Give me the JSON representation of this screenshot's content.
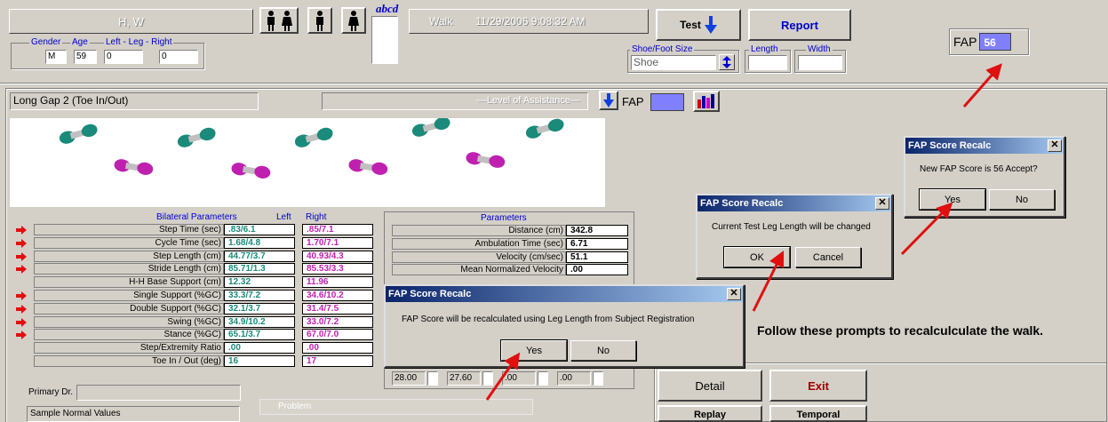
{
  "header": {
    "patient_name": "H, W",
    "gender_label": "Gender",
    "age_label": "Age",
    "leg_label": "Left - Leg - Right",
    "gender": "M",
    "age": "59",
    "left_leg": "0",
    "right_leg": "0",
    "abcd_label": "abcd",
    "test_type": "Walk",
    "test_datetime": "11/29/2006 9:08:32 AM",
    "test_button": "Test",
    "report_button": "Report",
    "shoe_group_label": "Shoe/Foot Size",
    "shoe_value": "Shoe",
    "length_label": "Length",
    "width_label": "Width",
    "fap_label": "FAP",
    "fap_value": "56"
  },
  "walk": {
    "name": "Long Gap 2 (Toe In/Out)",
    "assistance_label": "Level of Assistance",
    "fap_label": "FAP",
    "left_color": "#1a8a7a",
    "right_color": "#c020b0"
  },
  "bilateral": {
    "header": "Bilateral  Parameters",
    "left_header": "Left",
    "right_header": "Right",
    "rows": [
      {
        "label": "Step Time (sec)",
        "left": ".83/6.1",
        "right": ".85/7.1",
        "flag": true
      },
      {
        "label": "Cycle Time (sec)",
        "left": "1.68/4.8",
        "right": "1.70/7.1",
        "flag": true
      },
      {
        "label": "Step Length (cm)",
        "left": "44.77/3.7",
        "right": "40.93/4.3",
        "flag": true
      },
      {
        "label": "Stride Length (cm)",
        "left": "85.71/1.3",
        "right": "85.53/3.3",
        "flag": true
      },
      {
        "label": "H-H Base Support (cm)",
        "left": "12.32",
        "right": "11.96",
        "flag": false
      },
      {
        "label": "Single Support (%GC)",
        "left": "33.3/7.2",
        "right": "34.6/10.2",
        "flag": true
      },
      {
        "label": "Double Support (%GC)",
        "left": "32.1/3.7",
        "right": "31.4/7.5",
        "flag": true
      },
      {
        "label": "Swing (%GC)",
        "left": "34.9/10.2",
        "right": "33.0/7.2",
        "flag": true
      },
      {
        "label": "Stance (%GC)",
        "left": "65.1/3.7",
        "right": "67.0/7.0",
        "flag": true
      },
      {
        "label": "Step/Extremity Ratio",
        "left": ".00",
        "right": ".00",
        "flag": false
      },
      {
        "label": "Toe In / Out (deg)",
        "left": "16",
        "right": "17",
        "flag": false
      }
    ]
  },
  "parameters": {
    "header": "Parameters",
    "rows": [
      {
        "label": "Distance (cm)",
        "value": "342.8"
      },
      {
        "label": "Ambulation Time (sec)",
        "value": "6.71"
      },
      {
        "label": "Velocity (cm/sec)",
        "value": "51.1"
      },
      {
        "label": "Mean Normalized Velocity",
        "value": ".00"
      }
    ],
    "bottom_values": [
      "28.00",
      "27.60",
      ".00",
      ".00"
    ]
  },
  "footer": {
    "primary_dr_label": "Primary Dr.",
    "sample_label": "Sample Normal Values",
    "problem_label": "Problem",
    "detail_button": "Detail",
    "exit_button": "Exit",
    "replay_button": "Replay",
    "temporal_button": "Temporal"
  },
  "dialogs": {
    "d1": {
      "title": "FAP Score Recalc",
      "message": "FAP Score will be recalculated using Leg Length from Subject Registration",
      "yes": "Yes",
      "no": "No"
    },
    "d2": {
      "title": "FAP Score Recalc",
      "message": "Current Test Leg Length will be changed",
      "ok": "OK",
      "cancel": "Cancel"
    },
    "d3": {
      "title": "FAP Score Recalc",
      "message": "New FAP Score is 56 Accept?",
      "yes": "Yes",
      "no": "No"
    }
  },
  "annotation": {
    "instruction": "Follow these prompts to recalculculate the walk.",
    "arrow_color": "#e01010"
  }
}
